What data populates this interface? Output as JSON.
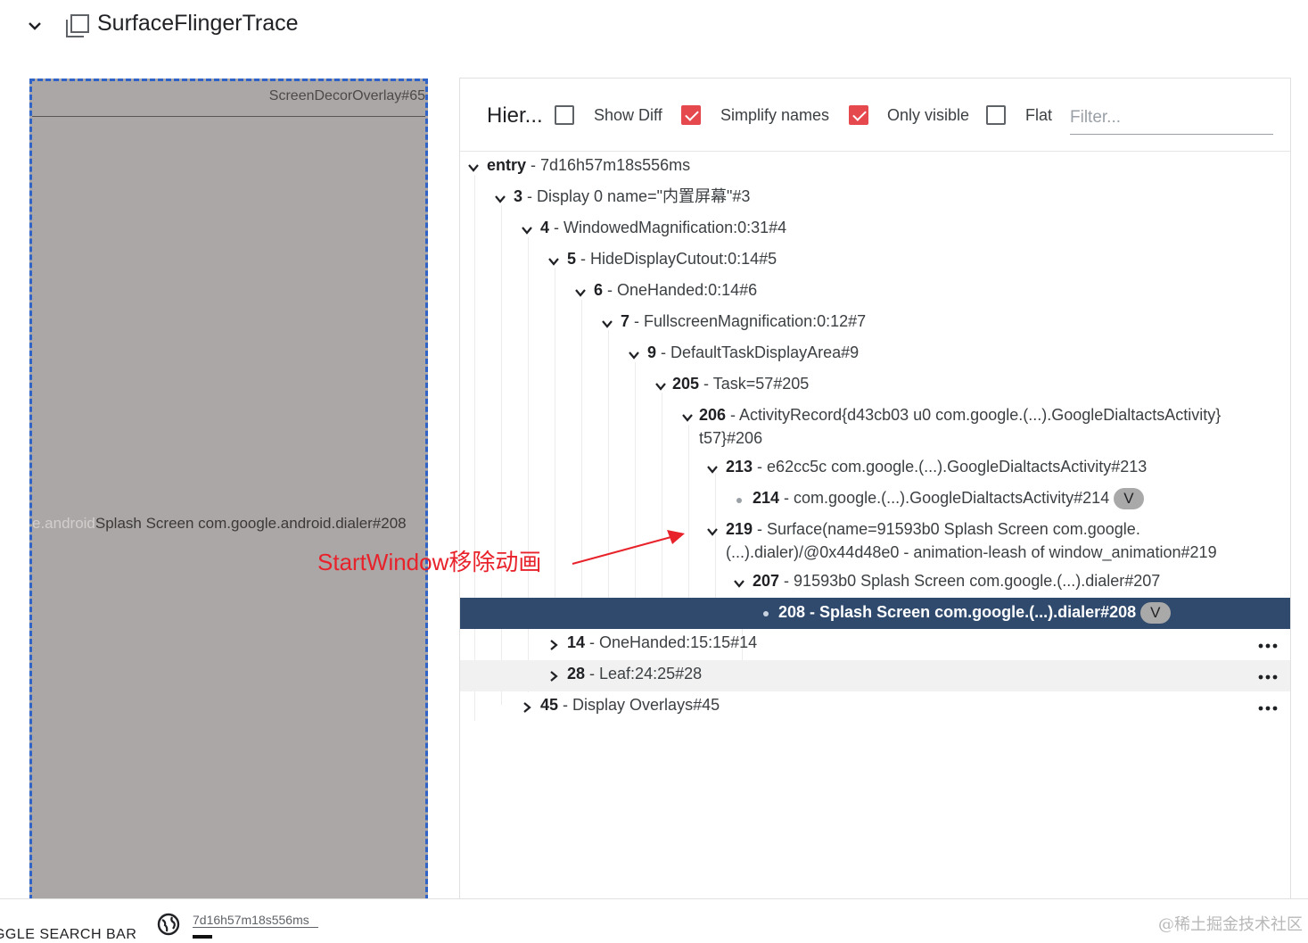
{
  "header": {
    "title": "SurfaceFlingerTrace",
    "collapse_icon": "chevron-down-icon",
    "trace_icon": "copy-icon"
  },
  "preview": {
    "top_label": "ScreenDecorOverlay#65",
    "mid_faded": "e.android",
    "mid_label": "Splash Screen com.google.android.dialer#208"
  },
  "annotation": {
    "text": "StartWindow移除动画",
    "color": "#e8222b"
  },
  "toolbar": {
    "title": "Hier...",
    "show_diff": {
      "label": "Show Diff",
      "checked": false
    },
    "simplify_names": {
      "label": "Simplify names",
      "checked": true
    },
    "only_visible": {
      "label": "Only visible",
      "checked": true
    },
    "flat": {
      "label": "Flat",
      "checked": false
    },
    "filter_placeholder": "Filter...",
    "filter_value": ""
  },
  "tree": {
    "selected_color": "#2f4a6d",
    "nodes": [
      {
        "id": "entry",
        "name": " - 7d16h57m18s556ms",
        "expanded": true
      },
      {
        "id": "3",
        "name": " - Display 0 name=\"内置屏幕\"#3",
        "expanded": true
      },
      {
        "id": "4",
        "name": " - WindowedMagnification:0:31#4",
        "expanded": true
      },
      {
        "id": "5",
        "name": " - HideDisplayCutout:0:14#5",
        "expanded": true
      },
      {
        "id": "6",
        "name": " - OneHanded:0:14#6",
        "expanded": true
      },
      {
        "id": "7",
        "name": " - FullscreenMagnification:0:12#7",
        "expanded": true
      },
      {
        "id": "9",
        "name": " - DefaultTaskDisplayArea#9",
        "expanded": true
      },
      {
        "id": "205",
        "name": " - Task=57#205",
        "expanded": true
      },
      {
        "id": "206",
        "name": " - ActivityRecord{d43cb03 u0 com.google.(...).GoogleDialtactsActivity}",
        "name2": "t57}#206",
        "expanded": true
      },
      {
        "id": "213",
        "name": " - e62cc5c com.google.(...).GoogleDialtactsActivity#213",
        "expanded": true
      },
      {
        "id": "214",
        "name": " - com.google.(...).GoogleDialtactsActivity#214",
        "badge": "V",
        "leaf": true
      },
      {
        "id": "219",
        "name": " - Surface(name=91593b0 Splash Screen com.google.",
        "name2": "(...).dialer)/@0x44d48e0 - animation-leash of window_animation#219",
        "expanded": true
      },
      {
        "id": "207",
        "name": " - 91593b0 Splash Screen com.google.(...).dialer#207",
        "expanded": true
      },
      {
        "id": "208",
        "name": " - Splash Screen com.google.(...).dialer#208",
        "badge": "V",
        "leaf": true,
        "selected": true
      },
      {
        "id": "14",
        "name": " - OneHanded:15:15#14",
        "expanded": false
      },
      {
        "id": "28",
        "name": " - Leaf:24:25#28",
        "expanded": false
      },
      {
        "id": "45",
        "name": " - Display Overlays#45",
        "expanded": false
      }
    ]
  },
  "bottombar": {
    "left_text": "OGGLE SEARCH BAR",
    "globe_icon": "globe-icon",
    "timestamp": "7d16h57m18s556ms",
    "watermark": "@稀土掘金技术社区"
  }
}
